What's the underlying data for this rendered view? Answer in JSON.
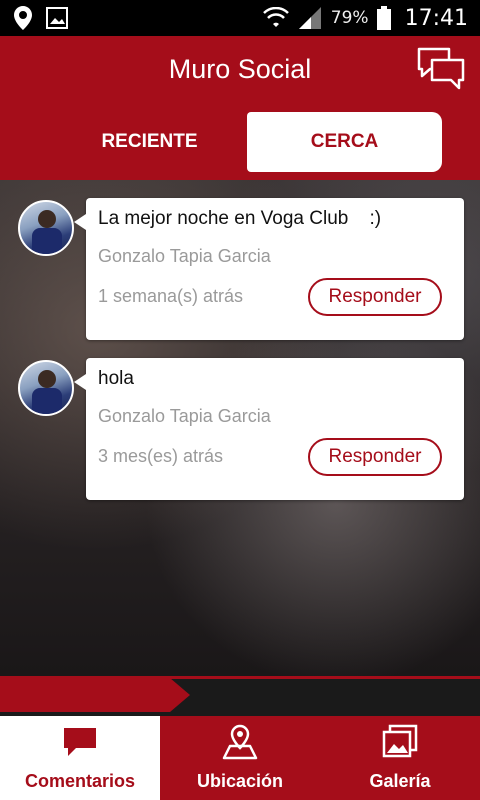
{
  "status_bar": {
    "battery": "79%",
    "time": "17:41"
  },
  "header": {
    "title": "Muro Social",
    "tabs": [
      {
        "label": "RECIENTE",
        "active": false
      },
      {
        "label": "CERCA",
        "active": true
      }
    ]
  },
  "posts": [
    {
      "message": "La mejor noche en Voga Club    :)",
      "author": "Gonzalo Tapia Garcia",
      "time": "1 semana(s) atrás",
      "reply_label": "Responder"
    },
    {
      "message": "hola",
      "author": "Gonzalo Tapia Garcia",
      "time": "3 mes(es) atrás",
      "reply_label": "Responder"
    }
  ],
  "bottom_nav": [
    {
      "label": "Comentarios",
      "icon": "speech-bubble-icon",
      "active": true
    },
    {
      "label": "Ubicación",
      "icon": "map-pin-icon",
      "active": false
    },
    {
      "label": "Galería",
      "icon": "gallery-icon",
      "active": false
    }
  ],
  "colors": {
    "brand": "#a50d1a"
  }
}
